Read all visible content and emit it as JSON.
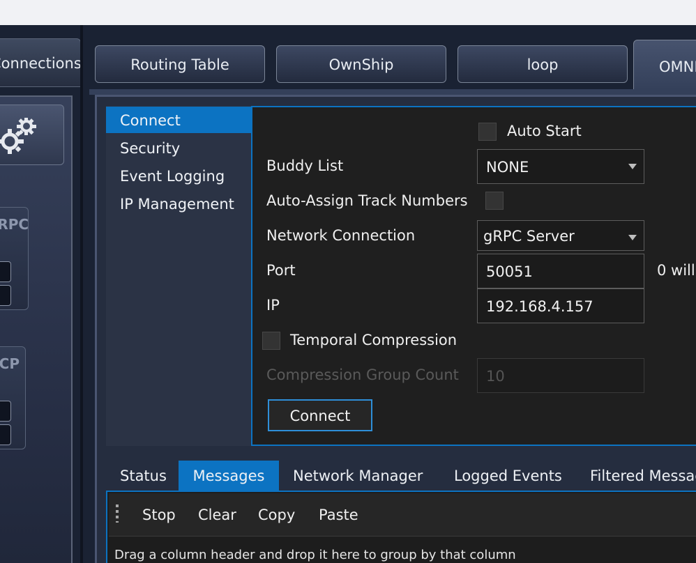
{
  "left_panel": {
    "tab_label": "Connections",
    "card1_title": "gRPC",
    "card2_title": "TCP"
  },
  "tabs": [
    {
      "label": "Routing Table"
    },
    {
      "label": "OwnShip"
    },
    {
      "label": "loop"
    },
    {
      "label": "OMNI"
    }
  ],
  "nav": {
    "items": [
      {
        "label": "Connect",
        "selected": true
      },
      {
        "label": "Security"
      },
      {
        "label": "Event Logging"
      },
      {
        "label": "IP Management"
      }
    ]
  },
  "form": {
    "auto_start_label": "Auto Start",
    "auto_start_checked": false,
    "buddy_list_label": "Buddy List",
    "buddy_list_value": "NONE",
    "auto_assign_label": "Auto-Assign Track Numbers",
    "auto_assign_checked": false,
    "network_connection_label": "Network Connection",
    "network_connection_value": "gRPC Server",
    "port_label": "Port",
    "port_value": "50051",
    "port_note": "0 will",
    "ip_label": "IP",
    "ip_value": "192.168.4.157",
    "temporal_label": "Temporal Compression",
    "temporal_checked": false,
    "group_count_label": "Compression Group Count",
    "group_count_value": "10",
    "connect_button": "Connect"
  },
  "bottom_tabs": [
    {
      "label": "Status"
    },
    {
      "label": "Messages",
      "selected": true
    },
    {
      "label": "Network Manager"
    },
    {
      "label": "Logged Events"
    },
    {
      "label": "Filtered Messages"
    }
  ],
  "toolbar": {
    "stop": "Stop",
    "clear": "Clear",
    "copy": "Copy",
    "paste": "Paste"
  },
  "grid_hint": "Drag a column header and drop it here to group by that column",
  "colors": {
    "accent": "#0c73c2",
    "background": "#1a2233",
    "form_bg": "#1f1f1f"
  }
}
